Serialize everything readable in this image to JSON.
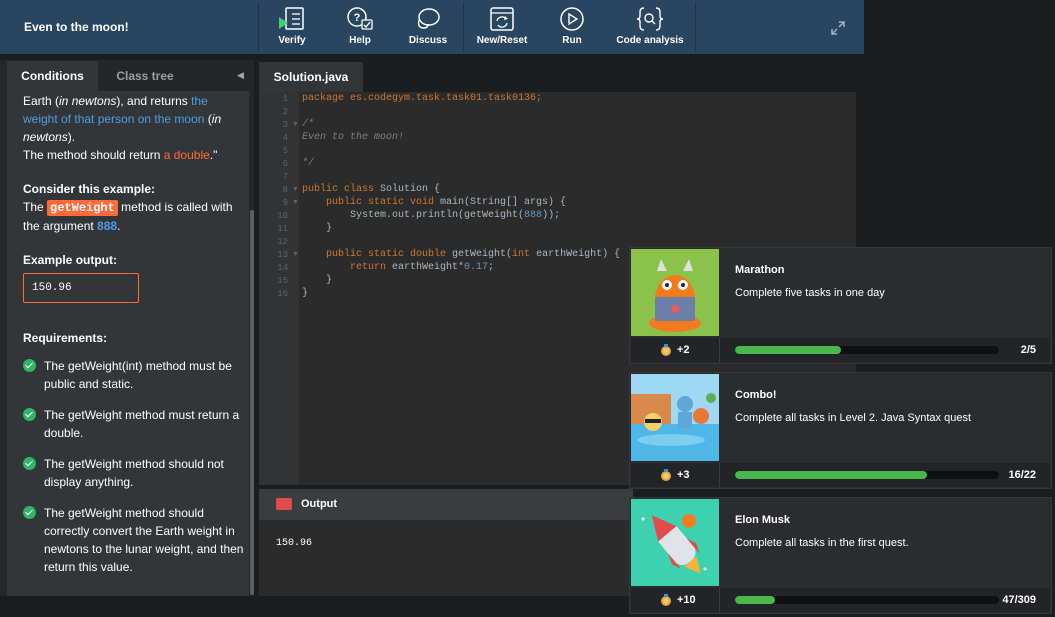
{
  "toolbar": {
    "title": "Even to the moon!",
    "buttons": [
      {
        "label": "Verify",
        "icon": "verify-icon"
      },
      {
        "label": "Help",
        "icon": "help-icon"
      },
      {
        "label": "Discuss",
        "icon": "discuss-icon"
      },
      {
        "label": "New/Reset",
        "icon": "reset-icon"
      },
      {
        "label": "Run",
        "icon": "run-icon"
      },
      {
        "label": "Code analysis",
        "icon": "code-analysis-icon"
      }
    ],
    "accent": "#294560"
  },
  "left_panel": {
    "tabs": [
      "Conditions",
      "Class tree"
    ],
    "intro": {
      "p1": "Earth (",
      "p2": "in newtons",
      "p3": "), and returns ",
      "p4": "the weight of that person on the moon",
      "p5": " (",
      "p6": "in newtons",
      "p7": ").",
      "p8": "The method should return ",
      "p9": "a double",
      "p10": ".\""
    },
    "example": {
      "heading": "Consider this example:",
      "t1": "The ",
      "method": "getWeight",
      "t2": " method is called with the argument ",
      "argument": "888",
      "t3": "."
    },
    "output": {
      "heading": "Example output:",
      "value": "150.96"
    },
    "requirements": {
      "heading": "Requirements:",
      "items": [
        "The getWeight(int) method must be public and static.",
        "The getWeight method must return a double.",
        "The getWeight method should not display anything.",
        "The getWeight method should correctly convert the Earth weight in newtons to the lunar weight, and then return this value."
      ]
    }
  },
  "editor": {
    "file_tab": "Solution.java",
    "line_numbers": [
      "1",
      "2",
      "3",
      "4",
      "5",
      "6",
      "7",
      "8",
      "9",
      "10",
      "11",
      "12",
      "13",
      "14",
      "15",
      "16"
    ],
    "code": {
      "l1": "package es.codegym.task.task01.task0136;",
      "l3": "/*",
      "l4": "Even to the moon!",
      "l6": "*/",
      "l8a": "public class",
      "l8b": " Solution {",
      "l9a": "    public static void",
      "l9b": " main(String[] args) {",
      "l10a": "        System.out.println(getWeight(",
      "l10b": "888",
      "l10c": "));",
      "l11": "    }",
      "l13a": "    public static double",
      "l13b": " getWeight(",
      "l13c": "int",
      "l13d": " earthWeight) {",
      "l14a": "        return",
      "l14b": " earthWeight*",
      "l14c": "0.17",
      "l14d": ";",
      "l15": "    }",
      "l16": "}"
    }
  },
  "output_panel": {
    "label": "Output",
    "text": "150.96"
  },
  "achievements": [
    {
      "title": "Marathon",
      "description": "Complete five tasks in one day",
      "points": "+2",
      "count": "2/5",
      "progress": 0.4,
      "image_bg": "#8bc34a"
    },
    {
      "title": "Combo!",
      "description": "Complete all tasks in Level 2. Java Syntax quest",
      "points": "+3",
      "count": "16/22",
      "progress": 0.727,
      "image_bg": "#9fd8f2"
    },
    {
      "title": "Elon Musk",
      "description": "Complete all tasks in the first quest.",
      "points": "+10",
      "count": "47/309",
      "progress": 0.152,
      "image_bg": "#3ed1b0"
    }
  ]
}
